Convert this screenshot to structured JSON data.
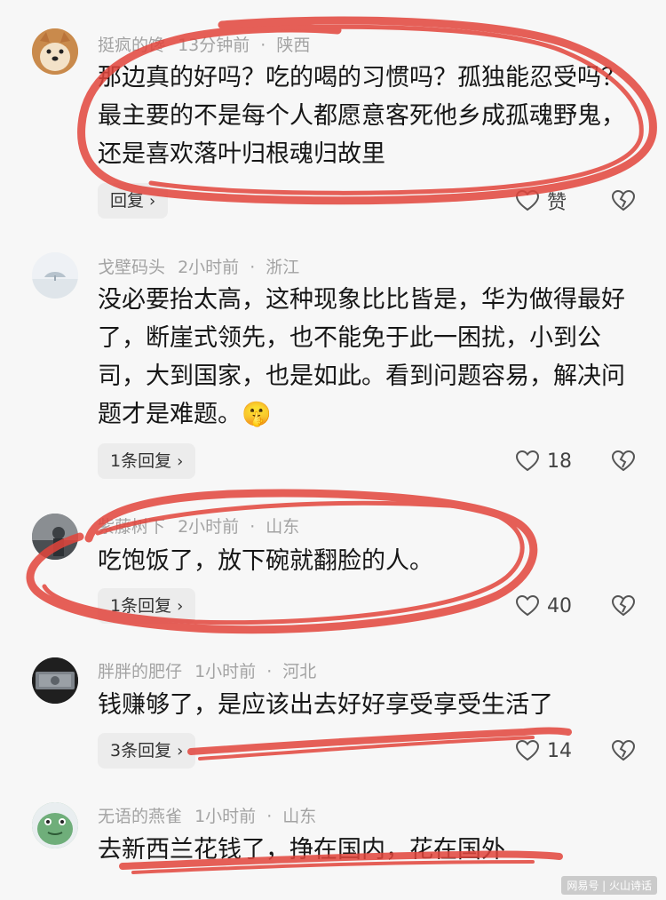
{
  "comments": [
    {
      "username": "挺疯的馋",
      "time": "13分钟前",
      "location": "陕西",
      "content": "那边真的好吗？吃的喝的习惯吗？孤独能忍受吗？最主要的不是每个人都愿意客死他乡成孤魂野鬼，还是喜欢落叶归根魂归故里",
      "reply_label": "回复",
      "like_label": "赞",
      "avatar_icon": "shiba-dog-avatar"
    },
    {
      "username": "戈壁码头",
      "time": "2小时前",
      "location": "浙江",
      "content": "没必要抬太高，这种现象比比皆是，华为做得最好了，断崖式领先，也不能免于此一困扰，小到公司，大到国家，也是如此。看到问题容易，解决问题才是难题。",
      "emoji": "🤫",
      "reply_label": "1条回复",
      "like_label": "18",
      "avatar_icon": "tree-landscape-avatar"
    },
    {
      "username": "紫藤树下",
      "time": "2小时前",
      "location": "山东",
      "content": "吃饱饭了，放下碗就翻脸的人。",
      "reply_label": "1条回复",
      "like_label": "40",
      "avatar_icon": "photo-avatar"
    },
    {
      "username": "胖胖的肥仔",
      "time": "1小时前",
      "location": "河北",
      "content": "钱赚够了，是应该出去好好享受享受生活了",
      "reply_label": "3条回复",
      "like_label": "14",
      "avatar_icon": "banknote-avatar"
    },
    {
      "username": "无语的燕雀",
      "time": "1小时前",
      "location": "山东",
      "content": "去新西兰花钱了，挣在国内，花在国外",
      "avatar_icon": "green-frog-avatar"
    }
  ],
  "watermark": "网易号 | 火山诗话",
  "colors": {
    "background": "#f7f7f7",
    "scribble": "#e2453c",
    "meta_text": "#a3a3a3"
  }
}
